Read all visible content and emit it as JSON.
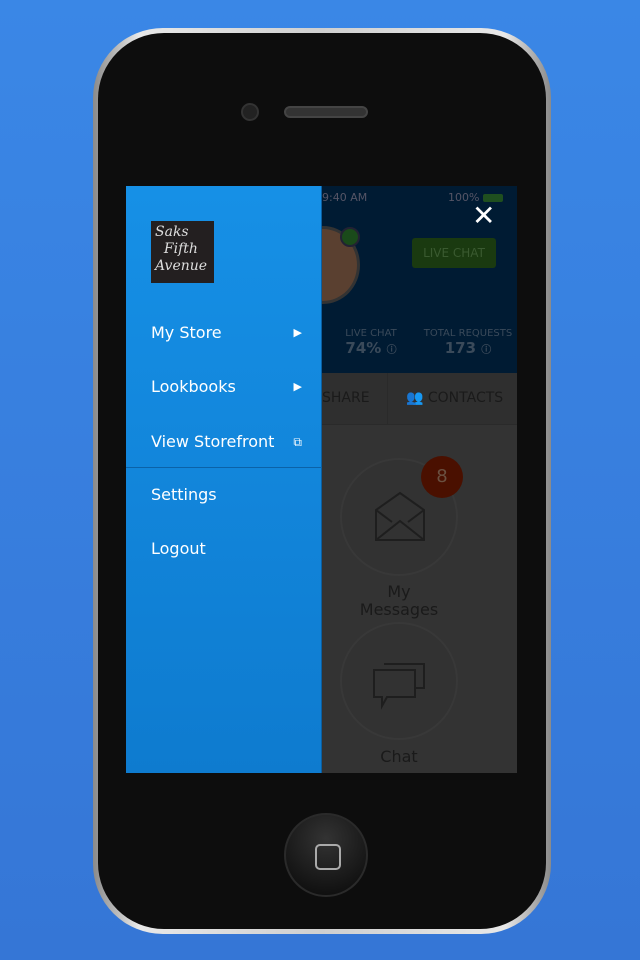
{
  "app": {
    "status": {
      "time": "9:40 AM",
      "battery": "100%"
    },
    "live_chat_button": "LIVE CHAT",
    "stats": [
      {
        "label": "LIVE CHAT",
        "value": "74%"
      },
      {
        "label": "TOTAL REQUESTS",
        "value": "173"
      }
    ],
    "tabs": [
      {
        "label": "SHARE"
      },
      {
        "label": "CONTACTS"
      }
    ],
    "tiles": [
      {
        "label_1": "My",
        "label_2": "Messages",
        "badge": "8"
      },
      {
        "label_1": "Chat"
      }
    ]
  },
  "drawer": {
    "logo": "Saks Fifth Avenue",
    "items": [
      {
        "label": "My Store",
        "icon": "chevron-right-icon"
      },
      {
        "label": "Lookbooks",
        "icon": "chevron-right-icon"
      },
      {
        "label": "View Storefront",
        "icon": "external-link-icon"
      },
      {
        "label": "Settings"
      },
      {
        "label": "Logout"
      }
    ],
    "close_icon": "close-icon"
  },
  "colors": {
    "drawer": "#1690e6",
    "background": "#3a87e6"
  }
}
